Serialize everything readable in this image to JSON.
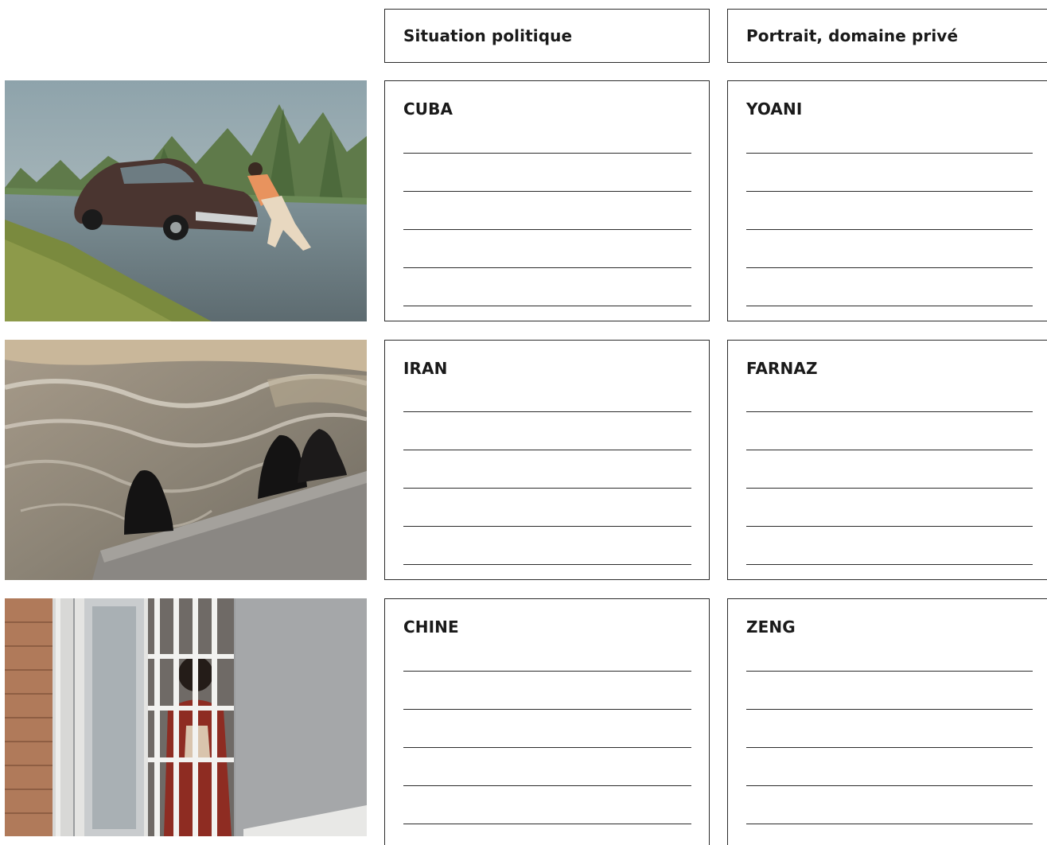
{
  "header": {
    "col1": "Situation politique",
    "col2": "Portrait, domaine privé"
  },
  "rows": [
    {
      "country": "CUBA",
      "person": "YOANI"
    },
    {
      "country": "IRAN",
      "person": "FARNAZ"
    },
    {
      "country": "CHINE",
      "person": "ZENG"
    }
  ]
}
